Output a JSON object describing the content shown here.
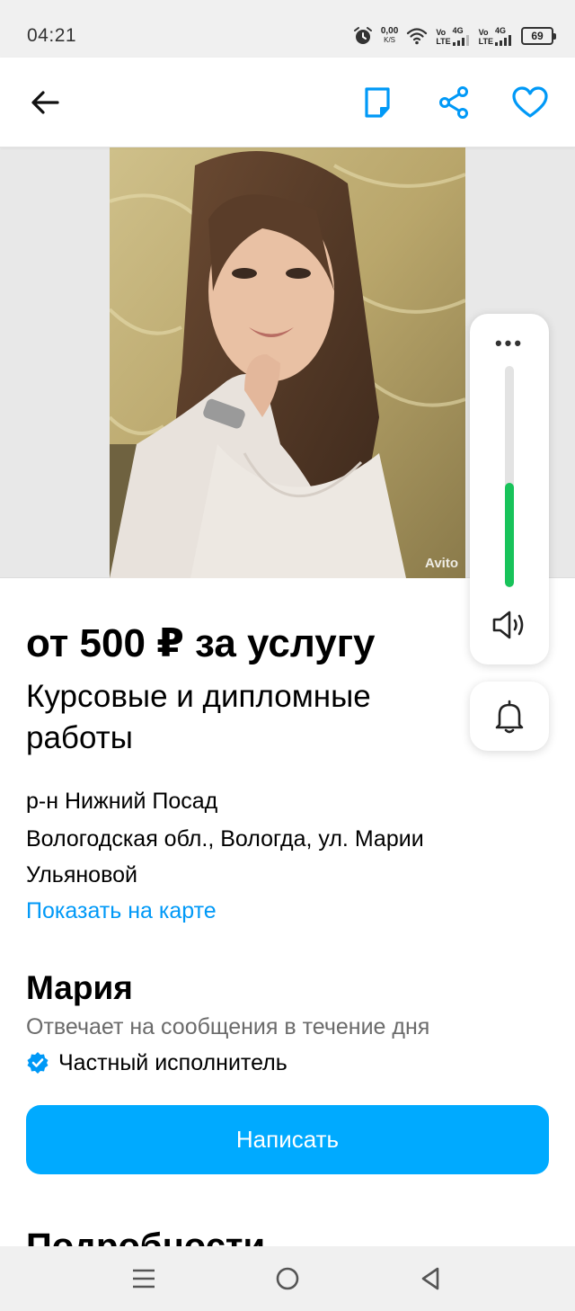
{
  "status_bar": {
    "time": "04:21",
    "net_speed_value": "0,00",
    "net_speed_unit": "K/S",
    "sim1_tag_top": "Vo",
    "sim1_tag_bottom": "LTE",
    "sim1_network": "4G",
    "sim2_tag_top": "Vo",
    "sim2_tag_bottom": "LTE",
    "sim2_network": "4G",
    "battery_level": "69",
    "icons": [
      "alarm-icon",
      "wifi-icon",
      "signal-icon",
      "battery-icon"
    ]
  },
  "app_bar": {
    "icons": [
      "arrow-left-icon",
      "note-icon",
      "share-icon",
      "heart-icon"
    ],
    "accent_color": "#0099f7"
  },
  "photo": {
    "watermark": "Avito"
  },
  "volume_panel": {
    "more_label": "•••",
    "level": 0.47,
    "fill_color": "#18c35a",
    "icons": [
      "speaker-icon",
      "bell-icon"
    ]
  },
  "listing": {
    "price": "от 500 ₽ за услугу",
    "title": "Курсовые и дипломные работы",
    "district": "р-н Нижний Посад",
    "address": "Вологодская обл., Вологда, ул. Марии Ульяновой",
    "map_link": "Показать на карте"
  },
  "seller": {
    "name": "Мария",
    "response_time": "Отвечает на сообщения в течение дня",
    "status": "Частный исполнитель"
  },
  "actions": {
    "write_label": "Написать",
    "button_color": "#00aaff"
  },
  "details": {
    "heading": "Подробности"
  },
  "nav_bar": {
    "icons": [
      "menu-icon",
      "home-circle-icon",
      "back-triangle-icon"
    ]
  }
}
